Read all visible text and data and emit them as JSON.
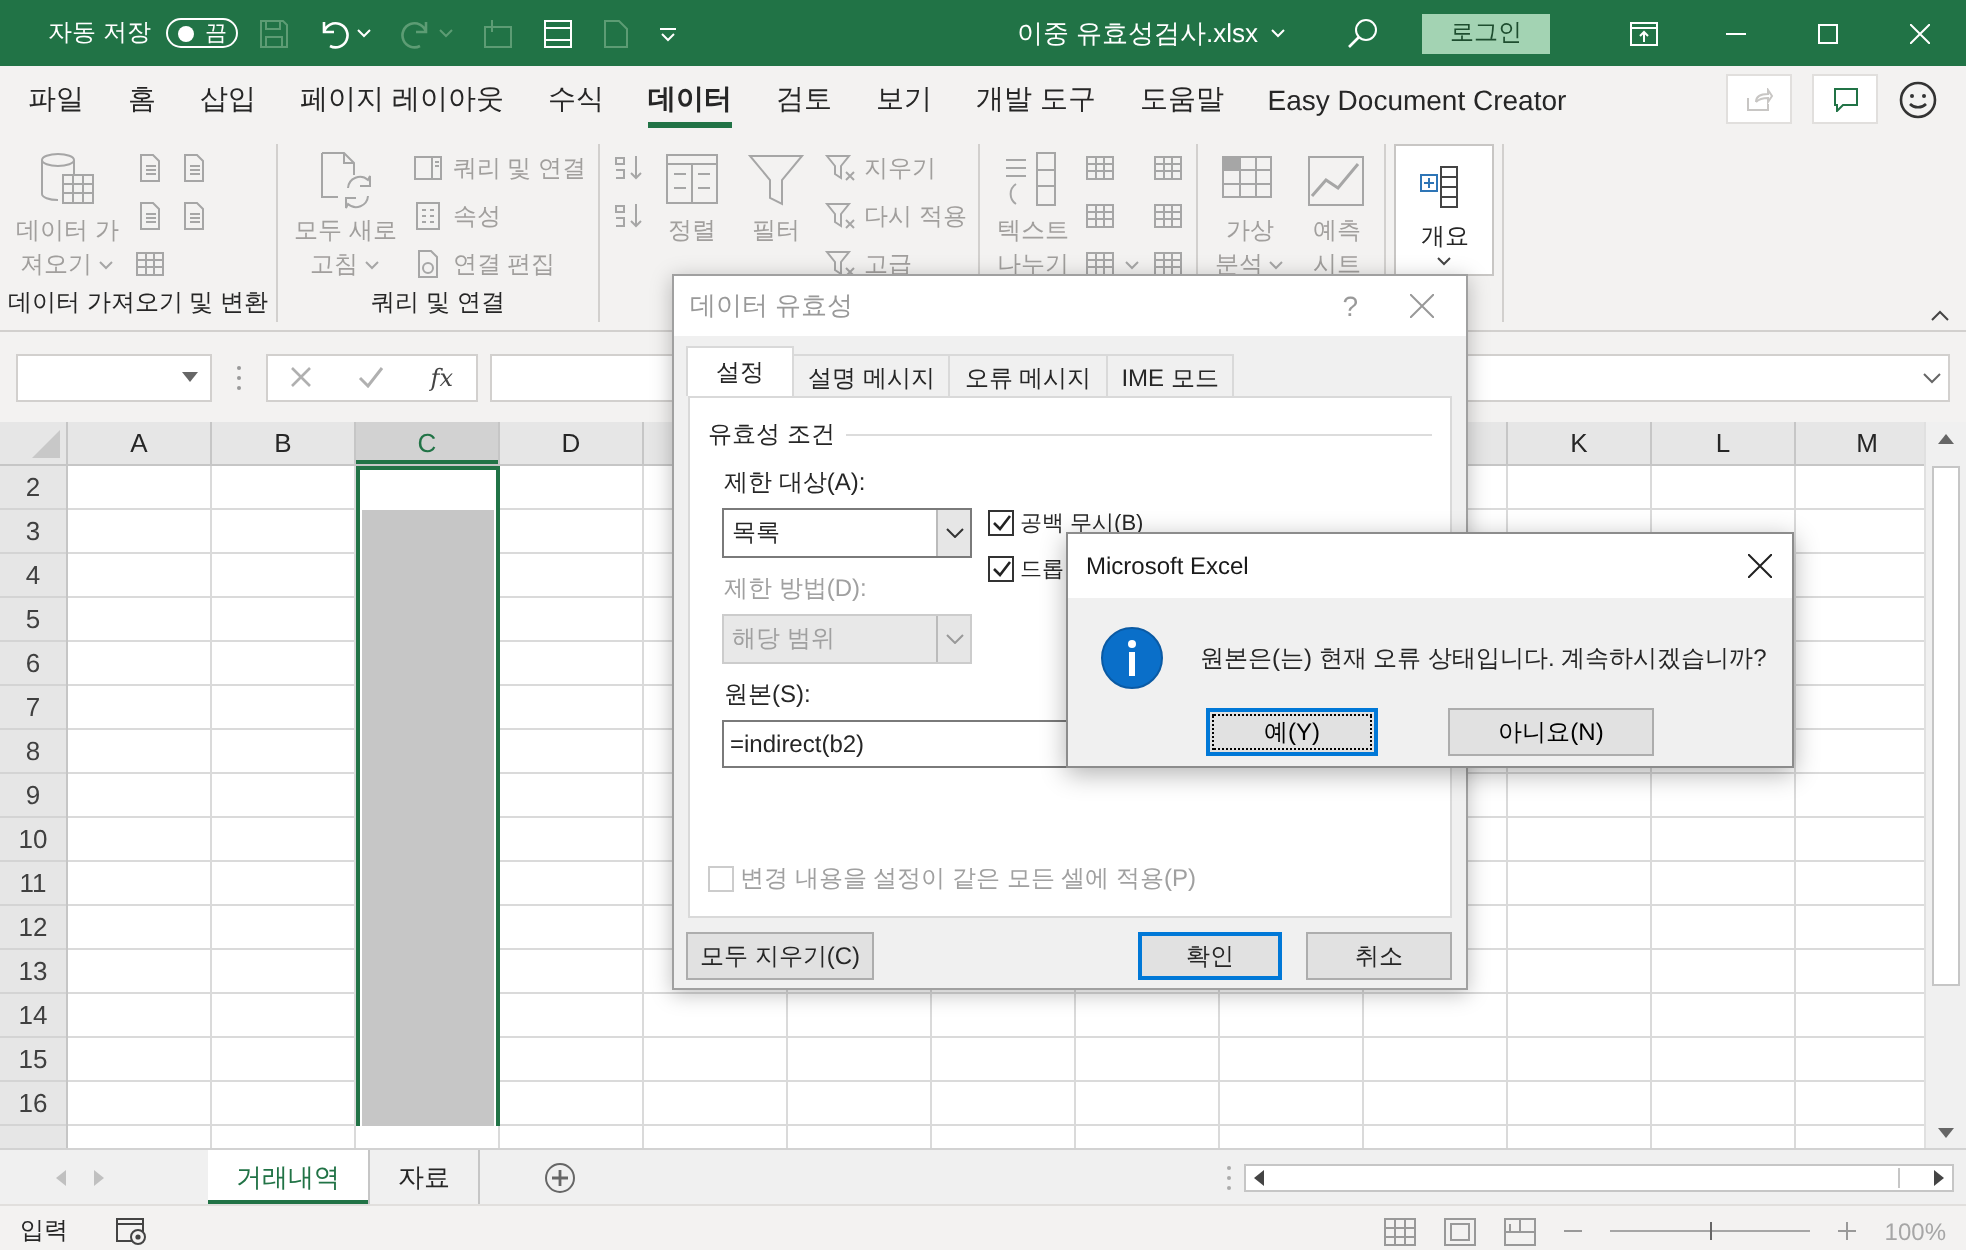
{
  "title_bar": {
    "autosave_label": "자동 저장",
    "autosave_toggle": {
      "label": "끔",
      "on": false
    },
    "file_name": "이중 유효성검사.xlsx",
    "login_button": "로그인"
  },
  "menu_tabs": [
    {
      "label": "파일",
      "selected": false
    },
    {
      "label": "홈",
      "selected": false
    },
    {
      "label": "삽입",
      "selected": false
    },
    {
      "label": "페이지 레이아웃",
      "selected": false
    },
    {
      "label": "수식",
      "selected": false
    },
    {
      "label": "데이터",
      "selected": true
    },
    {
      "label": "검토",
      "selected": false
    },
    {
      "label": "보기",
      "selected": false
    },
    {
      "label": "개발 도구",
      "selected": false
    },
    {
      "label": "도움말",
      "selected": false
    },
    {
      "label": "Easy Document Creator",
      "selected": false
    }
  ],
  "ribbon_groups": [
    {
      "label": "데이터 가져오기 및 변환",
      "columns": [
        {
          "kind": "large",
          "lines": [
            "데이터 가",
            "져오기"
          ],
          "dropdown": true,
          "disabled": true
        },
        {
          "kind": "stack",
          "buttons": [
            {
              "disabled": true
            },
            {
              "disabled": true
            },
            {
              "disabled": true
            }
          ]
        },
        {
          "kind": "stack",
          "buttons": [
            {
              "disabled": true
            },
            {
              "disabled": true
            }
          ]
        }
      ]
    },
    {
      "label": "쿼리 및 연결",
      "columns": [
        {
          "kind": "large",
          "lines": [
            "모두 새로",
            "고침"
          ],
          "dropdown": true,
          "disabled": true
        },
        {
          "kind": "stack",
          "buttons": [
            {
              "label": "쿼리 및 연결",
              "disabled": true
            },
            {
              "label": "속성",
              "disabled": true
            },
            {
              "label": "연결 편집",
              "disabled": true
            }
          ]
        }
      ]
    },
    {
      "columns": [
        {
          "kind": "stack",
          "buttons": [
            {
              "disabled": true
            },
            {
              "disabled": true
            }
          ]
        },
        {
          "kind": "large",
          "lines": [
            "정렬"
          ],
          "dropdown": false,
          "disabled": true
        },
        {
          "kind": "large",
          "lines": [
            "필터"
          ],
          "dropdown": false,
          "disabled": true
        },
        {
          "kind": "stack",
          "buttons": [
            {
              "label": "지우기",
              "disabled": true
            },
            {
              "label": "다시 적용",
              "disabled": true
            },
            {
              "label": "고급",
              "disabled": true
            }
          ]
        }
      ]
    },
    {
      "columns": [
        {
          "kind": "large",
          "lines": [
            "텍스트",
            "나누기"
          ],
          "dropdown": false,
          "disabled": true
        },
        {
          "kind": "stack",
          "buttons": [
            {
              "disabled": true
            },
            {
              "disabled": true
            },
            {
              "disabled": true,
              "dropdown": true
            }
          ]
        },
        {
          "kind": "stack",
          "buttons": [
            {
              "disabled": true
            },
            {
              "disabled": true
            },
            {
              "disabled": true
            }
          ]
        }
      ]
    },
    {
      "columns": [
        {
          "kind": "large",
          "lines": [
            "가상",
            "분석"
          ],
          "dropdown": true,
          "disabled": true
        },
        {
          "kind": "large",
          "lines": [
            "예측",
            "시트"
          ],
          "dropdown": false,
          "disabled": true
        }
      ]
    },
    {
      "columns": [
        {
          "kind": "large",
          "lines": [
            "개요"
          ],
          "dropdown": true,
          "disabled": false
        }
      ]
    }
  ],
  "formula_bar": {
    "function_button": "fx"
  },
  "sheet": {
    "columns_left": [
      {
        "label": "A",
        "selected": false
      },
      {
        "label": "B",
        "selected": false
      },
      {
        "label": "C",
        "selected": true
      },
      {
        "label": "D",
        "selected": false
      }
    ],
    "columns_right": [
      {
        "label": "K",
        "selected": false
      },
      {
        "label": "L",
        "selected": false
      },
      {
        "label": "M",
        "selected": false
      }
    ],
    "rows": [
      {
        "label": "2",
        "active_cell": true
      },
      {
        "label": "3",
        "active_cell": false
      },
      {
        "label": "4",
        "active_cell": false
      },
      {
        "label": "5",
        "active_cell": false
      },
      {
        "label": "6",
        "active_cell": false
      },
      {
        "label": "7",
        "active_cell": false
      },
      {
        "label": "8",
        "active_cell": false
      },
      {
        "label": "9",
        "active_cell": false
      },
      {
        "label": "10",
        "active_cell": false
      },
      {
        "label": "11",
        "active_cell": false
      },
      {
        "label": "12",
        "active_cell": false
      },
      {
        "label": "13",
        "active_cell": false
      },
      {
        "label": "14",
        "active_cell": false
      },
      {
        "label": "15",
        "active_cell": false
      },
      {
        "label": "16",
        "active_cell": false
      }
    ]
  },
  "sheet_tabs": [
    {
      "label": "거래내역",
      "selected": true
    },
    {
      "label": "자료",
      "selected": false
    }
  ],
  "status_bar": {
    "mode": "입력",
    "zoom": {
      "level": 0.5,
      "reading": "100%"
    }
  },
  "validation_dialog": {
    "title": "데이터 유효성",
    "help_button": "?",
    "tabs": [
      {
        "label": "설정",
        "selected": true
      },
      {
        "label": "설명 메시지",
        "selected": false
      },
      {
        "label": "오류 메시지",
        "selected": false
      },
      {
        "label": "IME 모드",
        "selected": false
      }
    ],
    "section_title": "유효성 조건",
    "allow_label": "제한 대상(A):",
    "allow_value": "목록",
    "data_label": "제한 방법(D):",
    "data_value": "해당 범위",
    "data_disabled": true,
    "checkboxes": [
      {
        "label": "공백 무시(B)",
        "checked": true
      },
      {
        "label": "드롭",
        "checked": true
      }
    ],
    "source_label": "원본(S):",
    "source_value": "=indirect(b2)",
    "apply_all": {
      "label": "변경 내용을 설정이 같은 모든 셀에 적용(P)",
      "checked": false,
      "disabled": true
    },
    "buttons": [
      {
        "label": "모두 지우기(C)",
        "default": false
      },
      {
        "label": "확인",
        "default": true
      },
      {
        "label": "취소",
        "default": false
      }
    ]
  },
  "message_box": {
    "title": "Microsoft Excel",
    "message": "원본은(는) 현재 오류 상태입니다. 계속하시겠습니까?",
    "buttons": [
      {
        "label": "예(Y)",
        "focused": true
      },
      {
        "label": "아니요(N)",
        "focused": false
      }
    ]
  }
}
